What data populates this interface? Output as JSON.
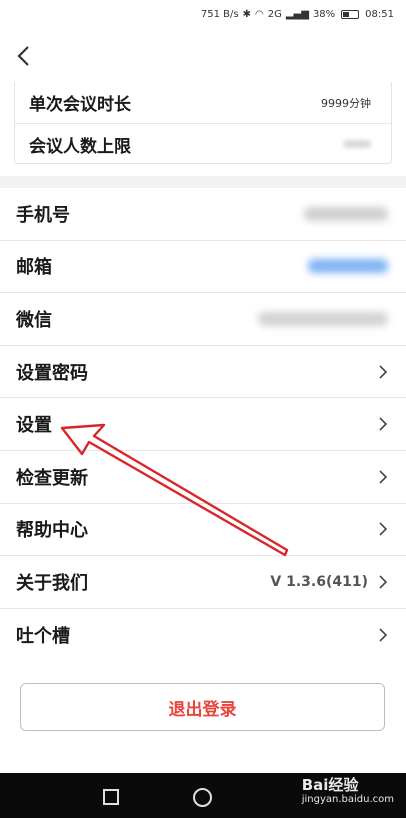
{
  "status_bar": {
    "speed": "751 B/s",
    "network": "2G",
    "battery": "38%",
    "time": "08:51"
  },
  "meeting": {
    "rows": [
      {
        "label": "单次会议时长",
        "value": "9999分钟"
      },
      {
        "label": "会议人数上限",
        "value": ""
      }
    ]
  },
  "menu": {
    "phone": "手机号",
    "email": "邮箱",
    "wechat": "微信",
    "password": "设置密码",
    "settings": "设置",
    "update": "检查更新",
    "help": "帮助中心",
    "about": "关于我们",
    "about_version": "V 1.3.6(411)",
    "feedback": "吐个槽"
  },
  "logout_label": "退出登录",
  "watermark": {
    "main": "Bai经验",
    "sub": "jingyan.baidu.com"
  },
  "colors": {
    "accent_red": "#e8453c",
    "annotation_red": "#d9262b",
    "email_blue": "#7fb3f5"
  }
}
